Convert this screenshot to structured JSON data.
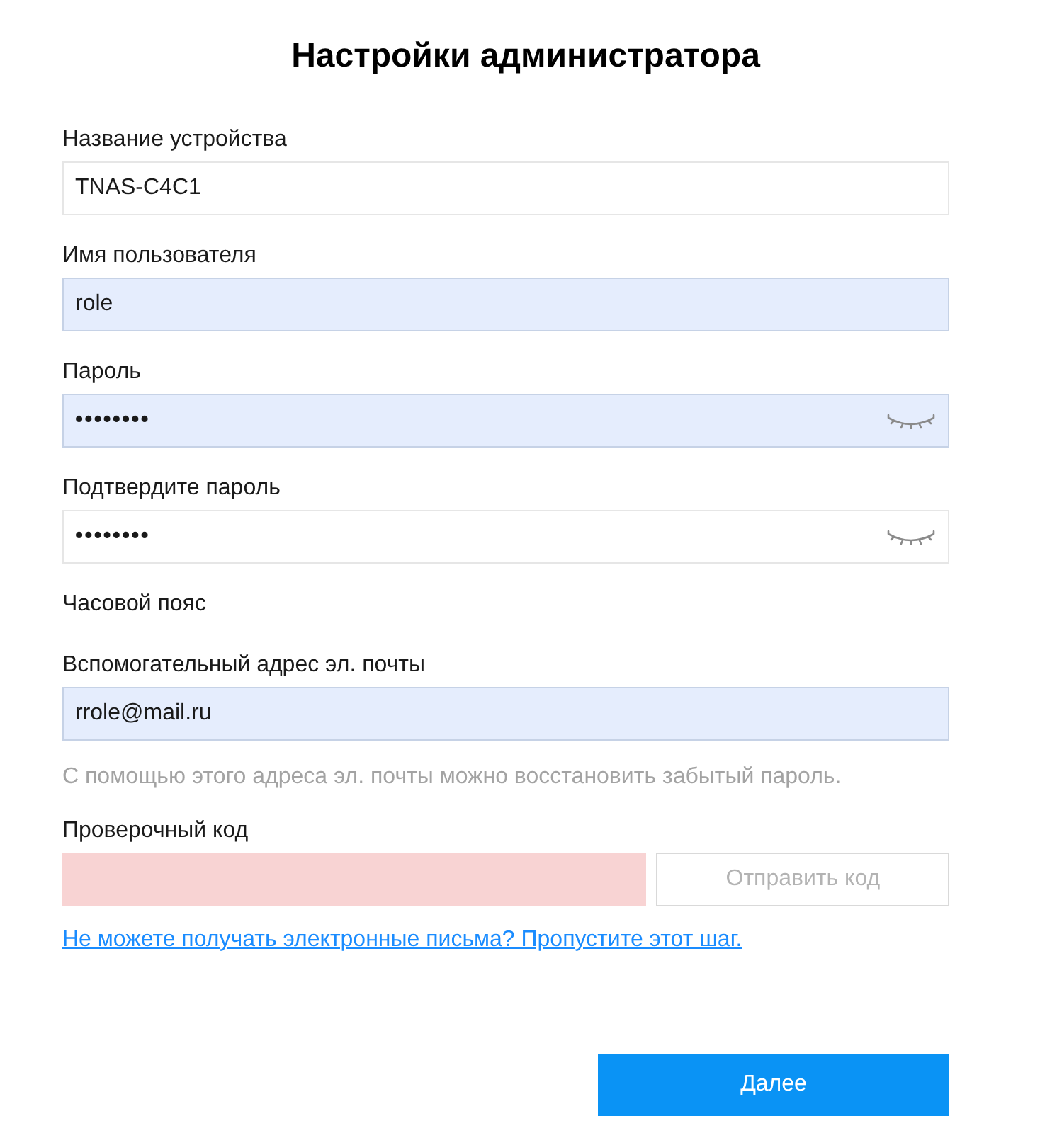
{
  "title": "Настройки администратора",
  "fields": [
    {
      "kind": "text",
      "label": "Название устройства",
      "value": "TNAS-C4C1",
      "autofilled": false,
      "invalid": false
    },
    {
      "kind": "text",
      "label": "Имя пользователя",
      "value": "role",
      "autofilled": true,
      "invalid": false
    },
    {
      "kind": "password",
      "label": "Пароль",
      "value": "••••••••",
      "autofilled": true,
      "invalid": false
    },
    {
      "kind": "password",
      "label": "Подтвердите пароль",
      "value": "••••••••",
      "autofilled": false,
      "invalid": false
    },
    {
      "kind": "label",
      "label": "Часовой пояс"
    },
    {
      "kind": "text",
      "label": "Вспомогательный адрес эл. почты",
      "value": "rrole@mail.ru",
      "autofilled": true,
      "invalid": false,
      "hint": "С помощью этого адреса эл. почты можно восстановить забытый пароль."
    },
    {
      "kind": "code",
      "label": "Проверочный код",
      "invalid": true,
      "button": {
        "label": "Отправить код",
        "disabled": true
      }
    }
  ],
  "skip_link": "Не можете получать электронные письма? Пропустите этот шаг.",
  "next_button": "Далее"
}
